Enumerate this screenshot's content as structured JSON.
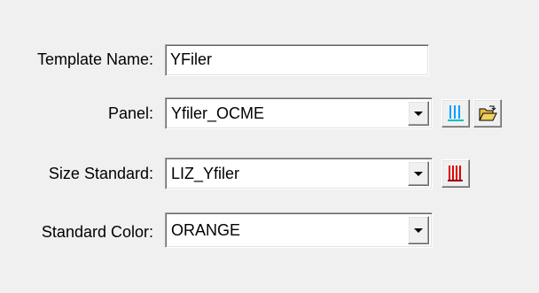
{
  "form": {
    "template_name_label": "Template Name:",
    "template_name_value": "YFiler",
    "panel_label": "Panel:",
    "panel_value": "Yfiler_OCME",
    "size_standard_label": "Size Standard:",
    "size_standard_value": "LIZ_Yfiler",
    "standard_color_label": "Standard Color:",
    "standard_color_value": "ORANGE"
  },
  "icons": {
    "panel_bins": "panel-bins-icon",
    "open_folder": "open-folder-icon",
    "size_standard_peaks": "size-standard-peaks-icon",
    "dropdown_arrow": "dropdown-arrow-icon"
  },
  "colors": {
    "background": "#f0f0f0",
    "panel_icon_bars": "#00a0ff",
    "panel_icon_base": "#00c0c0",
    "size_standard_icon": "#e00000",
    "folder": "#e8c040"
  }
}
